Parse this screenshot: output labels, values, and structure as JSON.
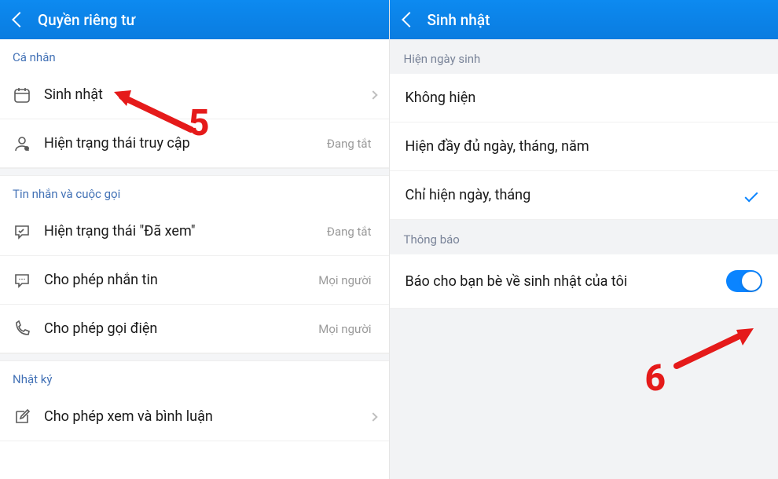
{
  "left": {
    "header": {
      "title": "Quyền riêng tư"
    },
    "sections": [
      {
        "header": "Cá nhân",
        "rows": [
          {
            "label": "Sinh nhật",
            "meta": ""
          },
          {
            "label": "Hiện trạng thái truy cập",
            "meta": "Đang tắt"
          }
        ]
      },
      {
        "header": "Tin nhắn và cuộc gọi",
        "rows": [
          {
            "label": "Hiện trạng thái \"Đã xem\"",
            "meta": "Đang tắt"
          },
          {
            "label": "Cho phép nhắn tin",
            "meta": "Mọi người"
          },
          {
            "label": "Cho phép gọi điện",
            "meta": "Mọi người"
          }
        ]
      },
      {
        "header": "Nhật ký",
        "rows": [
          {
            "label": "Cho phép xem và bình luận",
            "meta": ""
          }
        ]
      }
    ]
  },
  "right": {
    "header": {
      "title": "Sinh nhật"
    },
    "display_section": {
      "header": "Hiện ngày sinh",
      "options": [
        {
          "label": "Không hiện"
        },
        {
          "label": "Hiện đầy đủ ngày, tháng, năm"
        },
        {
          "label": "Chỉ hiện ngày, tháng"
        }
      ]
    },
    "notify_section": {
      "header": "Thông báo",
      "row": {
        "label": "Báo cho bạn bè về sinh nhật của tôi"
      }
    }
  },
  "annotations": {
    "step5": "5",
    "step6": "6"
  }
}
